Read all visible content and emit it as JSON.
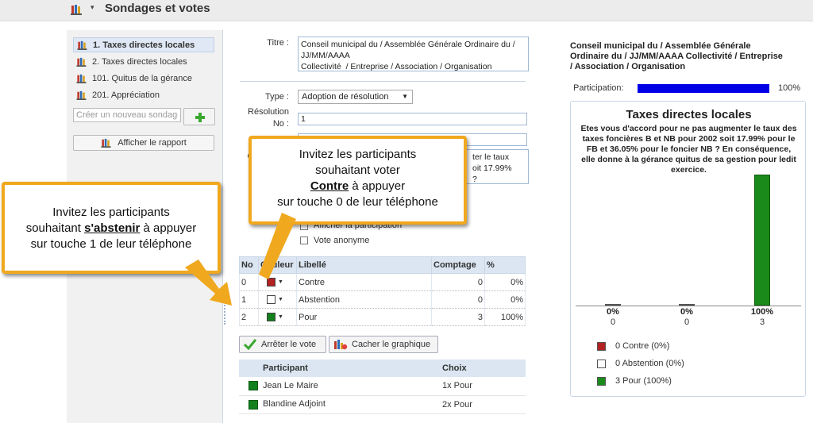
{
  "header": {
    "title": "Sondages et votes",
    "icon": "poll-books-icon"
  },
  "sidebar": {
    "items": [
      {
        "label": "1. Taxes directes locales",
        "active": true
      },
      {
        "label": "2. Taxes directes locales",
        "active": false
      },
      {
        "label": "101. Quitus de la gérance",
        "active": false
      },
      {
        "label": "201. Appréciation",
        "active": false
      }
    ],
    "new_poll_placeholder": "Créer un nouveau sondage",
    "report_button": "Afficher le rapport"
  },
  "form": {
    "title_label": "Titre :",
    "title_value": "Conseil municipal du / Assemblée Générale Ordinaire du / JJ/MM/AAAA\nCollectivité  / Entreprise / Association / Organisation",
    "type_label": "Type :",
    "type_value": "Adoption de résolution",
    "resolution_label_1": "Résolution",
    "resolution_label_2": "No :",
    "resolution_value": "1",
    "question_label": "Q",
    "question_partial_1": "ter le taux",
    "question_partial_2": "oit 17.99%",
    "question_partial_3": "?",
    "show_participation_label": "Afficher la participation",
    "anonymous_vote_label": "Vote anonyme"
  },
  "vote_table": {
    "headers": {
      "no": "No",
      "color": "Couleur",
      "label": "Libellé",
      "count": "Comptage",
      "pct": "%"
    },
    "rows": [
      {
        "no": "0",
        "color": "#b22222",
        "label": "Contre",
        "count": "0",
        "pct": "0%"
      },
      {
        "no": "1",
        "color": "#ffffff",
        "label": "Abstention",
        "count": "0",
        "pct": "0%"
      },
      {
        "no": "2",
        "color": "#12801c",
        "label": "Pour",
        "count": "3",
        "pct": "100%"
      }
    ]
  },
  "buttons": {
    "stop_vote": "Arrêter le vote",
    "hide_chart": "Cacher le graphique"
  },
  "participants": {
    "headers": {
      "participant": "Participant",
      "choice": "Choix"
    },
    "rows": [
      {
        "name": "Jean Le Maire",
        "choice": "1x Pour"
      },
      {
        "name": "Blandine Adjoint",
        "choice": "2x Pour"
      }
    ]
  },
  "results": {
    "title": "Conseil municipal du / Assemblée Générale Ordinaire du / JJ/MM/AAAA Collectivité / Entreprise / Association / Organisation",
    "participation_label": "Participation:",
    "participation_value": "100%",
    "participation_fraction": 1.0,
    "participation_color": "#0000e6"
  },
  "chart_data": {
    "type": "bar",
    "title": "Taxes directes locales",
    "subtitle": "Etes vous d'accord pour ne pas augmenter le taux des taxes foncières B et NB pour 2002 soit 17.99% pour le FB et 36.05% pour le foncier NB ? En conséquence, elle donne à la gérance quitus de sa gestion pour ledit exercice.",
    "categories": [
      "Contre",
      "Abstention",
      "Pour"
    ],
    "values": [
      0,
      0,
      3
    ],
    "percent_labels": [
      "0%",
      "0%",
      "100%"
    ],
    "count_labels": [
      "0",
      "0",
      "3"
    ],
    "colors": [
      "#b22222",
      "#ffffff",
      "#1a8a1a"
    ],
    "legend": [
      "0 Contre (0%)",
      "0 Abstention (0%)",
      "3 Pour (100%)"
    ],
    "legend_placement": "bottom-left",
    "grid": false
  },
  "callouts": {
    "contre_line1": "Invitez les participants",
    "contre_line2": "souhaitant voter",
    "contre_key": "Contre",
    "contre_line3": " à appuyer",
    "contre_line4": "sur touche 0 de leur téléphone",
    "abstenir_line1": "Invitez les participants",
    "abstenir_pre": "souhaitant ",
    "abstenir_key": "s'abstenir",
    "abstenir_post": " à appuyer",
    "abstenir_line3": "sur touche 1 de leur téléphone",
    "border_color": "#f0a81e"
  }
}
